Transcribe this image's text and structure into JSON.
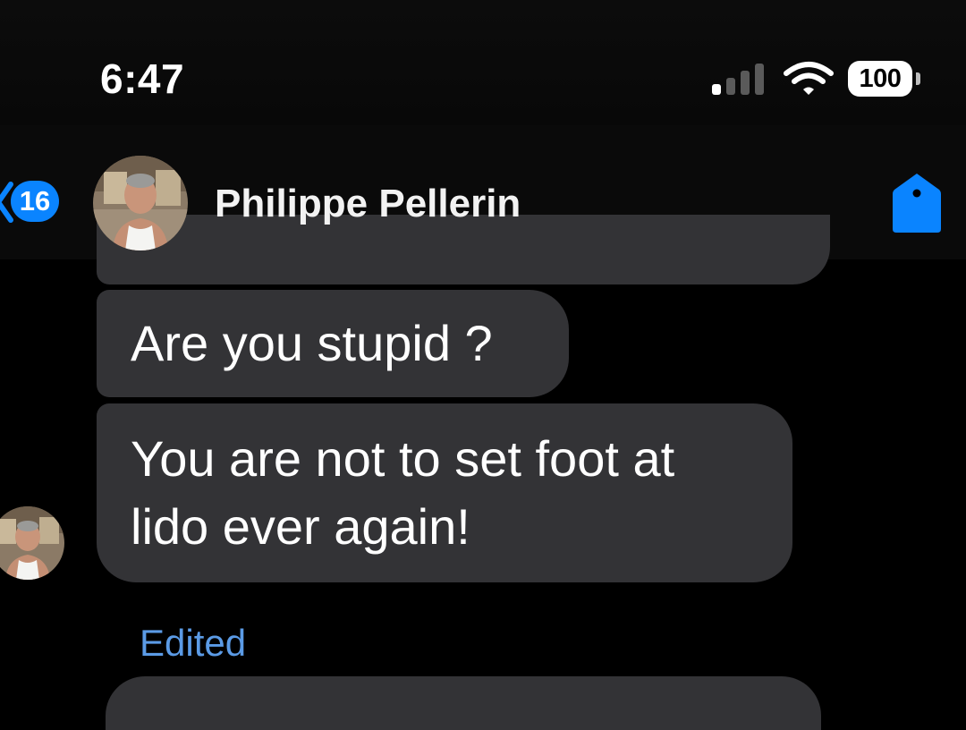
{
  "status_bar": {
    "time": "6:47",
    "battery": "100",
    "signal_icon": "cellular-signal-icon",
    "wifi_icon": "wifi-icon"
  },
  "header": {
    "unread_count": "16",
    "contact_name": "Philippe Pellerin",
    "tag_icon": "tag-icon",
    "accent_color": "#0a84ff"
  },
  "messages": [
    {
      "text": "Are you stupid ?"
    },
    {
      "text": "You are not to set foot at\nlido ever again!"
    }
  ],
  "edited_label": "Edited",
  "colors": {
    "background": "#000000",
    "bubble_incoming": "#333336",
    "edited_text": "#5b9be6"
  }
}
